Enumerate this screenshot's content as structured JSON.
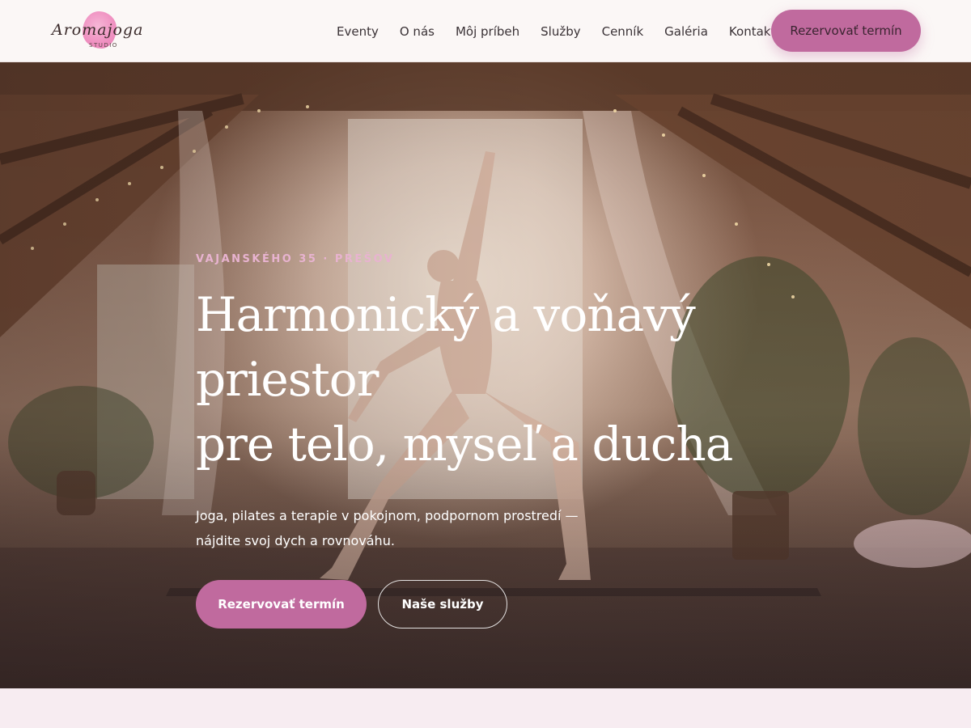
{
  "brand": {
    "logo_script": "Aromajoga",
    "logo_sub": "STUDIO",
    "accent_color": "#c06a9e"
  },
  "nav": {
    "items": [
      "Eventy",
      "O nás",
      "Môj príbeh",
      "Služby",
      "Cenník",
      "Galéria",
      "Kontakt"
    ],
    "cta_label": "Rezervovať termín"
  },
  "hero": {
    "eyebrow": "VAJANSKÉHO 35 · PREŠOV",
    "title_lines": [
      "Harmonický a voňavý",
      "priestor",
      "pre telo, myseľ a ducha"
    ],
    "text_lines": [
      "Joga, pilates a terapie v pokojnom, podpornom prostredí —",
      "nájdite svoj dych a rovnováhu."
    ],
    "primary_button": "Rezervovať termín",
    "secondary_button": "Naše služby",
    "background_image": "yoga-attic-photo"
  }
}
